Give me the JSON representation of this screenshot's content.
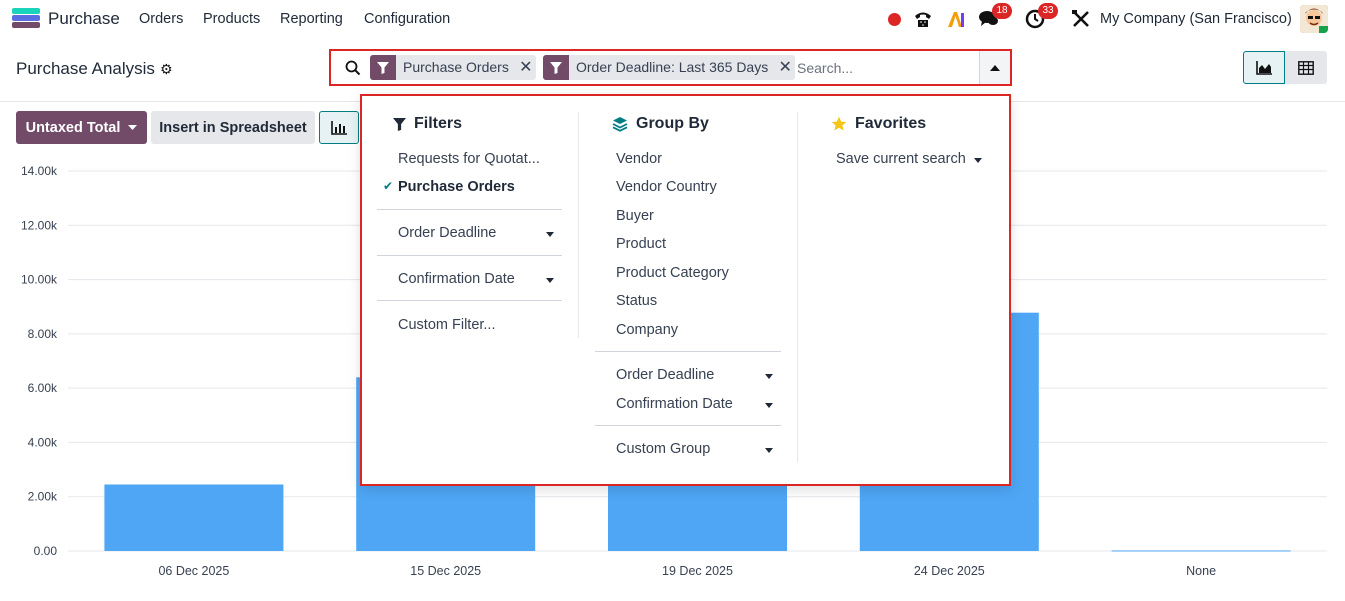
{
  "navbar": {
    "app_name": "Purchase",
    "menu": [
      "Orders",
      "Products",
      "Reporting",
      "Configuration"
    ],
    "chat_badge": "18",
    "activity_badge": "33",
    "company": "My Company (San Francisco)"
  },
  "control_panel": {
    "title": "Purchase Analysis",
    "facets": [
      "Purchase Orders",
      "Order Deadline: Last 365 Days"
    ],
    "search_placeholder": "Search...",
    "measure_button": "Untaxed Total",
    "insert_button": "Insert in Spreadsheet"
  },
  "dropdown": {
    "filters": {
      "heading": "Filters",
      "items": [
        "Requests for Quotat...",
        "Purchase Orders"
      ],
      "selected": "Purchase Orders",
      "date_items": [
        "Order Deadline",
        "Confirmation Date"
      ],
      "custom": "Custom Filter..."
    },
    "group_by": {
      "heading": "Group By",
      "items": [
        "Vendor",
        "Vendor Country",
        "Buyer",
        "Product",
        "Product Category",
        "Status",
        "Company"
      ],
      "date_items": [
        "Order Deadline",
        "Confirmation Date"
      ],
      "custom": "Custom Group"
    },
    "favorites": {
      "heading": "Favorites",
      "save": "Save current search"
    }
  },
  "colors": {
    "brand": "#714b67",
    "accent": "#017e84",
    "bar": "#4ea6f5",
    "highlight": "#dc2626"
  },
  "chart_data": {
    "type": "bar",
    "categories": [
      "06 Dec 2025",
      "15 Dec 2025",
      "19 Dec 2025",
      "24 Dec 2025",
      "None"
    ],
    "values": [
      2450,
      6400,
      6000,
      8780,
      20
    ],
    "ylim": [
      0,
      14000
    ],
    "yticks": [
      "0.00",
      "2.00k",
      "4.00k",
      "6.00k",
      "8.00k",
      "10.00k",
      "12.00k",
      "14.00k"
    ],
    "grid": true
  }
}
